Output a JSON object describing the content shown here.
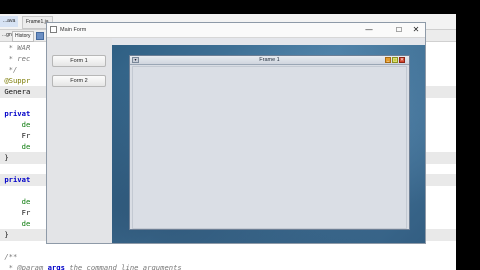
{
  "ide": {
    "tabs": [
      "...ava",
      "Frame1.ja"
    ],
    "toolbar": [
      "...gn",
      "History"
    ],
    "code_lines": [
      {
        "segments": [
          {
            "t": "  * WAR",
            "c": "c-cmt"
          }
        ]
      },
      {
        "segments": [
          {
            "t": "  * rec",
            "c": "c-cmt"
          }
        ]
      },
      {
        "segments": [
          {
            "t": "  */",
            "c": "c-cmt"
          }
        ]
      },
      {
        "segments": [
          {
            "t": " @Suppr",
            "c": "c-ann"
          }
        ]
      },
      {
        "segments": [
          {
            "t": " Genera",
            "c": ""
          }
        ],
        "hl": true
      },
      {
        "segments": [
          {
            "t": "",
            "c": ""
          }
        ]
      },
      {
        "segments": [
          {
            "t": " privat",
            "c": "c-kw"
          }
        ]
      },
      {
        "segments": [
          {
            "t": "     de",
            "c": "c-green"
          }
        ]
      },
      {
        "segments": [
          {
            "t": "     Fr",
            "c": ""
          }
        ]
      },
      {
        "segments": [
          {
            "t": "     de",
            "c": "c-green"
          }
        ]
      },
      {
        "segments": [
          {
            "t": " }",
            "c": ""
          }
        ],
        "hl": true
      },
      {
        "segments": [
          {
            "t": "",
            "c": ""
          }
        ]
      },
      {
        "segments": [
          {
            "t": " privat",
            "c": "c-kw"
          }
        ],
        "hl": true
      },
      {
        "segments": [
          {
            "t": "",
            "c": ""
          }
        ]
      },
      {
        "segments": [
          {
            "t": "     de",
            "c": "c-green"
          }
        ]
      },
      {
        "segments": [
          {
            "t": "     Fr",
            "c": ""
          }
        ]
      },
      {
        "segments": [
          {
            "t": "     de",
            "c": "c-green"
          }
        ]
      },
      {
        "segments": [
          {
            "t": " }",
            "c": ""
          }
        ],
        "hl": true
      },
      {
        "segments": [
          {
            "t": "",
            "c": ""
          }
        ]
      },
      {
        "segments": [
          {
            "t": " /**",
            "c": "c-cmt"
          }
        ]
      },
      {
        "segments": [
          {
            "t": "  * ",
            "c": "c-cmt"
          },
          {
            "t": "@param",
            "c": "c-cmt"
          },
          {
            "t": " args",
            "c": "c-kw"
          },
          {
            "t": " the command line arguments",
            "c": "c-cmt"
          }
        ]
      }
    ]
  },
  "main_window": {
    "title": "Main Form",
    "controls": {
      "minimize": "—",
      "maximize": "☐",
      "close": "✕"
    },
    "buttons": {
      "form1": "Form 1",
      "form2": "Form 2"
    }
  },
  "internal_frame": {
    "title": "Frame 1",
    "controls": {
      "sysmenu": "▾",
      "minimize": "_",
      "maximize": "□",
      "close": "✕"
    }
  },
  "colors": {
    "desktop_blue": "#3b6a8f",
    "iframe_close": "#d0442c",
    "iframe_min": "#e39b2e",
    "iframe_max": "#c9cf3e"
  }
}
